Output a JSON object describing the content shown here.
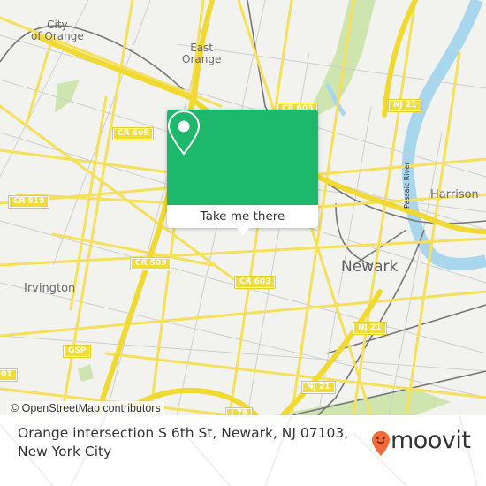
{
  "map": {
    "place_labels": [
      {
        "id": "city-of-orange",
        "text": "City of Orange"
      },
      {
        "id": "east-orange",
        "text": "East Orange"
      },
      {
        "id": "irvington",
        "text": "Irvington"
      },
      {
        "id": "newark",
        "text": "Newark"
      },
      {
        "id": "harrison",
        "text": "Harrison"
      }
    ],
    "place_lines": {
      "city_of_orange_1": "City",
      "city_of_orange_2": "of Orange",
      "east_orange_1": "East",
      "east_orange_2": "Orange"
    },
    "river_label": "Passaic River",
    "road_shields": {
      "cr605": "CR 605",
      "cr510": "CR 510",
      "cr509": "CR 509",
      "cr603": "CR 603",
      "cr603_top": "CR 603",
      "nj21_top": "NJ 21",
      "nj21_mid": "NJ 21",
      "nj21_low": "NJ 21",
      "gsp": "GSP",
      "cr_left_partial": "01",
      "i78": "I 78"
    },
    "colors": {
      "background": "#f2f2ef",
      "road_major": "#f5e05a",
      "road_minor": "#c8c8c8",
      "water": "#a8d6ec",
      "park": "#cfe5b0",
      "rail": "#777777"
    },
    "attribution": "© OpenStreetMap contributors"
  },
  "popup": {
    "icon": "map-pin-icon",
    "button_label": "Take me there",
    "color": "#1db86b"
  },
  "footer": {
    "address": "Orange intersection S 6th St, Newark, NJ 07103, New York City",
    "brand_name": "moovit",
    "brand_color": "#f26a3a"
  }
}
